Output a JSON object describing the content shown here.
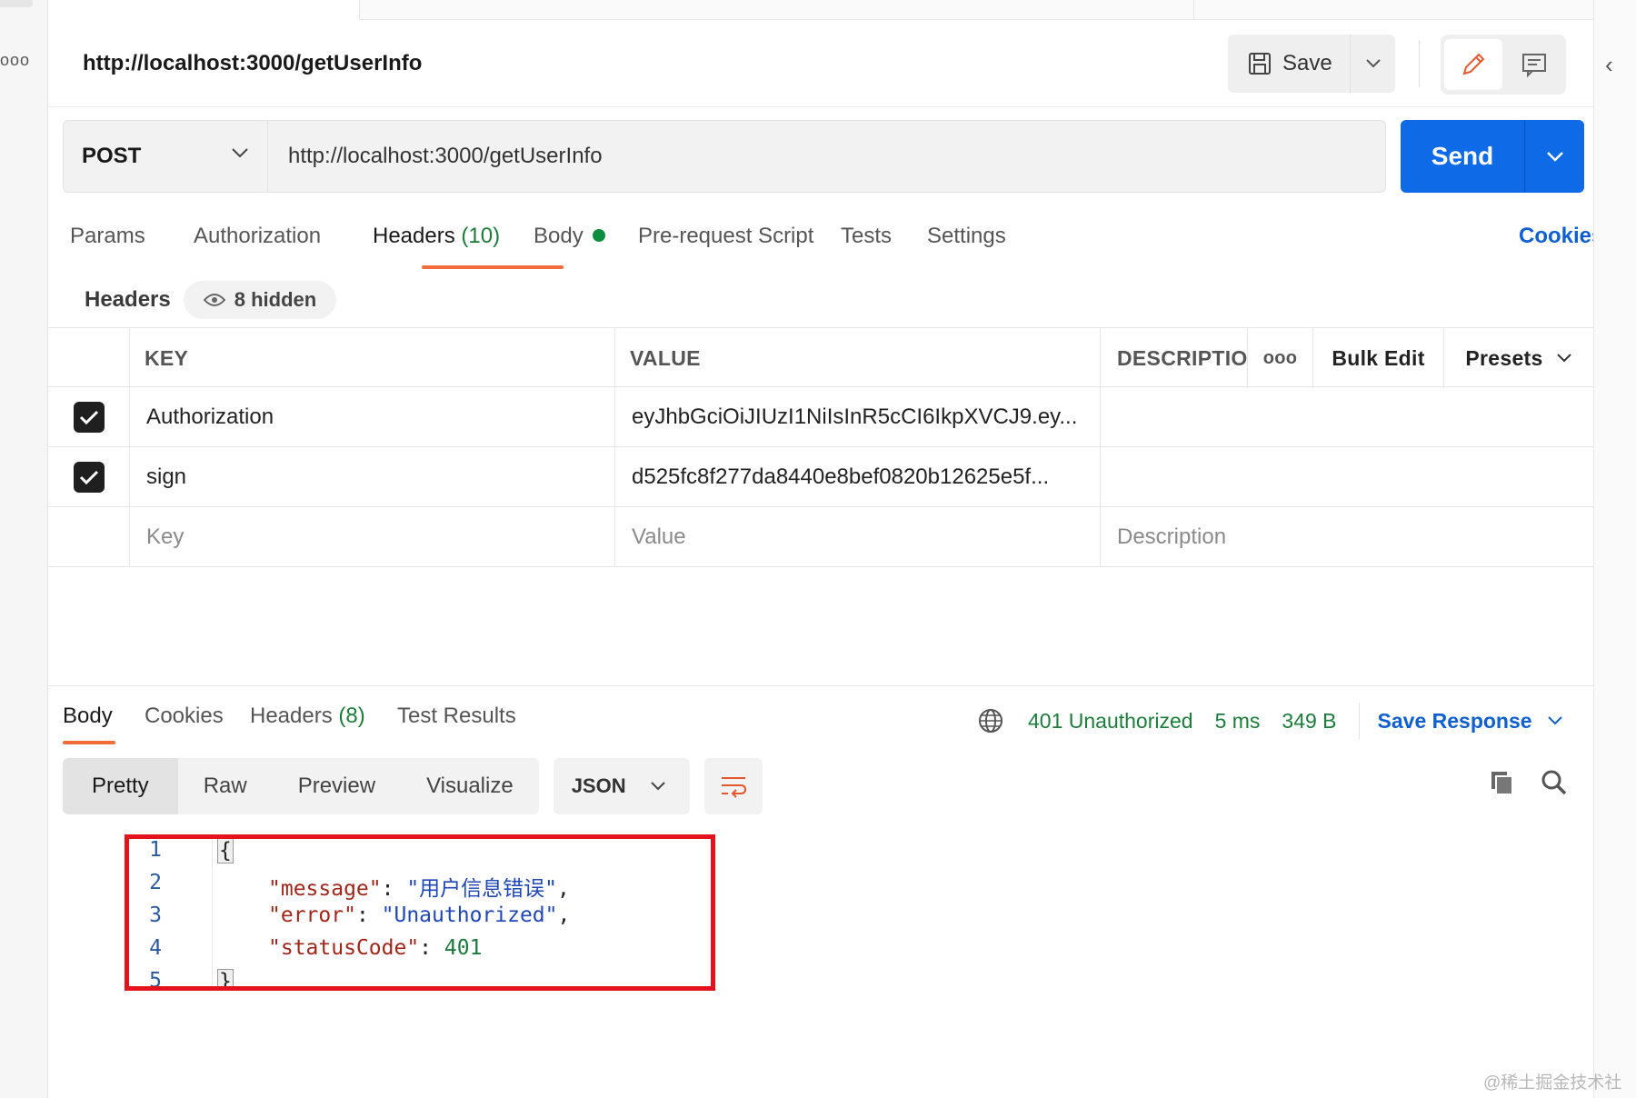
{
  "request": {
    "title": "http://localhost:3000/getUserInfo",
    "save_label": "Save",
    "method": "POST",
    "url": "http://localhost:3000/getUserInfo",
    "send_label": "Send"
  },
  "request_tabs": {
    "params": "Params",
    "authorization": "Authorization",
    "headers": "Headers",
    "headers_count": "(10)",
    "body": "Body",
    "prerequest": "Pre-request Script",
    "tests": "Tests",
    "settings": "Settings",
    "cookies": "Cookies",
    "active": "Headers"
  },
  "headers_panel": {
    "label": "Headers",
    "hidden_label": "8 hidden",
    "columns": {
      "key": "KEY",
      "value": "VALUE",
      "description": "DESCRIPTIO",
      "more": "ooo",
      "bulk_edit": "Bulk Edit",
      "presets": "Presets"
    },
    "rows": [
      {
        "checked": true,
        "key": "Authorization",
        "value": "eyJhbGciOiJIUzI1NiIsInR5cCI6IkpXVCJ9.ey...",
        "description": ""
      },
      {
        "checked": true,
        "key": "sign",
        "value": "d525fc8f277da8440e8bef0820b12625e5f...",
        "description": ""
      }
    ],
    "placeholders": {
      "key": "Key",
      "value": "Value",
      "description": "Description"
    }
  },
  "response": {
    "tabs": {
      "body": "Body",
      "cookies": "Cookies",
      "headers": "Headers",
      "headers_count": "(8)",
      "test_results": "Test Results"
    },
    "status": "401 Unauthorized",
    "time": "5 ms",
    "size": "349 B",
    "save_response": "Save Response",
    "views": {
      "pretty": "Pretty",
      "raw": "Raw",
      "preview": "Preview",
      "visualize": "Visualize"
    },
    "format": "JSON",
    "code_lines": {
      "l1": "1",
      "l2": "2",
      "l3": "3",
      "l4": "4",
      "l5": "5",
      "open_brace": "{",
      "close_brace": "}",
      "message_key": "\"message\"",
      "message_val": "\"用户信息错误\"",
      "error_key": "\"error\"",
      "error_val": "\"Unauthorized\"",
      "status_key": "\"statusCode\"",
      "status_val": "401"
    }
  },
  "watermark": "@稀土掘金技术社区",
  "colors": {
    "send_blue": "#0f6ae8",
    "link_blue": "#0f5fcf",
    "active_tab_orange": "#f26b3a",
    "status_green": "#1c7d3a",
    "highlight_red": "#e3121b"
  }
}
